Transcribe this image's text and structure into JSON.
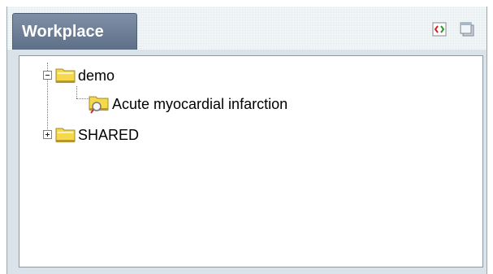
{
  "panel": {
    "tab_title": "Workplace",
    "header_icons": [
      "expand-all-icon",
      "window-icon"
    ]
  },
  "tree": {
    "nodes": [
      {
        "label": "demo",
        "icon": "folder-icon",
        "expanded": true
      },
      {
        "label": "Acute myocardial infarction",
        "icon": "analysis-folder-icon"
      },
      {
        "label": "SHARED",
        "icon": "folder-icon",
        "expanded": false
      }
    ]
  },
  "colors": {
    "tab_bg": "#6b7c94",
    "header_bg": "#dfeaf0",
    "folder_yellow": "#f5d94a"
  }
}
